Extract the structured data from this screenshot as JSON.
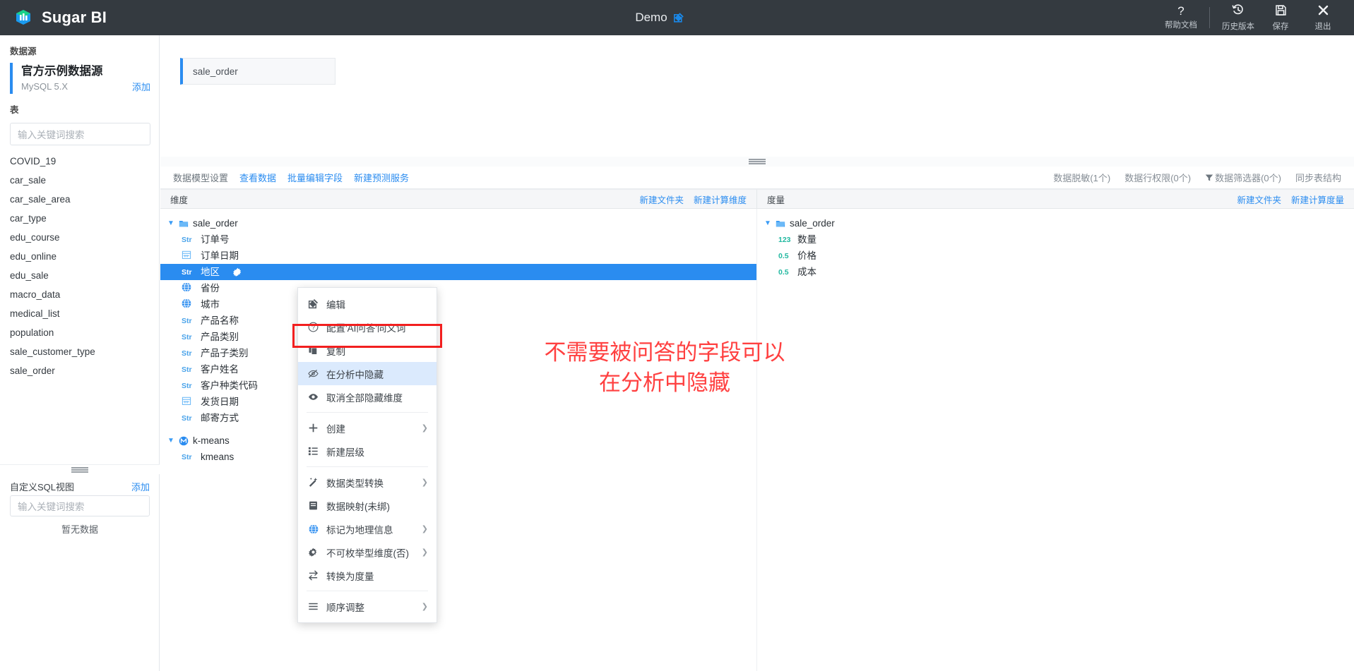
{
  "header": {
    "brand": "Sugar BI",
    "logo_icon": "cube-logo-icon",
    "doc_title": "Demo",
    "edit_icon": "edit-pencil-icon",
    "actions": [
      {
        "icon": "question-mark-icon",
        "glyph": "?",
        "label": "帮助文档"
      },
      {
        "icon": "history-clock-icon",
        "glyph": "",
        "label": "历史版本"
      },
      {
        "icon": "save-floppy-icon",
        "glyph": "",
        "label": "保存"
      },
      {
        "icon": "close-x-icon",
        "glyph": "✕",
        "label": "退出"
      }
    ]
  },
  "sidebar": {
    "datasource_label": "数据源",
    "datasource": {
      "name": "官方示例数据源",
      "sub": "MySQL 5.X",
      "add_label": "添加"
    },
    "tables_label": "表",
    "table_search_placeholder": "输入关键词搜索",
    "tables": [
      "COVID_19",
      "car_sale",
      "car_sale_area",
      "car_type",
      "edu_course",
      "edu_online",
      "edu_sale",
      "macro_data",
      "medical_list",
      "population",
      "sale_customer_type",
      "sale_order"
    ],
    "sqlview": {
      "title": "自定义SQL视图",
      "add_label": "添加",
      "search_placeholder": "输入关键词搜索",
      "empty_text": "暂无数据"
    }
  },
  "canvas": {
    "node_label": "sale_order"
  },
  "model_toolbar": {
    "left": [
      {
        "text": "数据模型设置",
        "link": false
      },
      {
        "text": "查看数据",
        "link": true
      },
      {
        "text": "批量编辑字段",
        "link": true
      },
      {
        "text": "新建预测服务",
        "link": true
      }
    ],
    "right": [
      {
        "text": "数据脱敏(1个)",
        "icon": ""
      },
      {
        "text": "数据行权限(0个)",
        "icon": ""
      },
      {
        "text": "数据筛选器(0个)",
        "icon": "filter-funnel-icon"
      },
      {
        "text": "同步表结构",
        "icon": ""
      }
    ]
  },
  "dimension_panel": {
    "title": "维度",
    "links": [
      "新建文件夹",
      "新建计算维度"
    ],
    "groups": [
      {
        "name": "sale_order",
        "icon": "folder-icon",
        "fields": [
          {
            "label": "订单号",
            "type": "Str",
            "icon": "string-type-icon"
          },
          {
            "label": "订单日期",
            "type": "date",
            "icon": "calendar-icon"
          },
          {
            "label": "地区",
            "type": "Str",
            "icon": "string-type-icon",
            "selected": true,
            "gear": "gear-icon"
          },
          {
            "label": "省份",
            "type": "geo",
            "icon": "globe-icon"
          },
          {
            "label": "城市",
            "type": "geo",
            "icon": "globe-icon"
          },
          {
            "label": "产品名称",
            "type": "Str",
            "icon": "string-type-icon"
          },
          {
            "label": "产品类别",
            "type": "Str",
            "icon": "string-type-icon"
          },
          {
            "label": "产品子类别",
            "type": "Str",
            "icon": "string-type-icon"
          },
          {
            "label": "客户姓名",
            "type": "Str",
            "icon": "string-type-icon"
          },
          {
            "label": "客户种类代码",
            "type": "Str",
            "icon": "string-type-icon"
          },
          {
            "label": "发货日期",
            "type": "date",
            "icon": "calendar-icon"
          },
          {
            "label": "邮寄方式",
            "type": "Str",
            "icon": "string-type-icon"
          }
        ]
      },
      {
        "name": "k-means",
        "icon": "model-circle-icon",
        "fields": [
          {
            "label": "kmeans",
            "type": "Str",
            "icon": "string-type-icon"
          }
        ]
      }
    ]
  },
  "measure_panel": {
    "title": "度量",
    "links": [
      "新建文件夹",
      "新建计算度量"
    ],
    "groups": [
      {
        "name": "sale_order",
        "icon": "folder-icon",
        "fields": [
          {
            "label": "数量",
            "type": "123",
            "icon": "integer-type-icon"
          },
          {
            "label": "价格",
            "type": "0.5",
            "icon": "decimal-type-icon"
          },
          {
            "label": "成本",
            "type": "0.5",
            "icon": "decimal-type-icon"
          }
        ]
      }
    ]
  },
  "context_menu": {
    "items": [
      {
        "label": "编辑",
        "icon": "edit-square-icon",
        "arrow": false,
        "active": false,
        "sep_after": false
      },
      {
        "label": "配置'AI问答'同义词",
        "icon": "question-circle-icon",
        "arrow": false,
        "active": false,
        "sep_after": false
      },
      {
        "label": "复制",
        "icon": "copy-icon",
        "arrow": false,
        "active": false,
        "sep_after": false
      },
      {
        "label": "在分析中隐藏",
        "icon": "eye-slash-icon",
        "arrow": false,
        "active": true,
        "sep_after": false
      },
      {
        "label": "取消全部隐藏维度",
        "icon": "eye-icon",
        "arrow": false,
        "active": false,
        "sep_after": true
      },
      {
        "label": "创建",
        "icon": "plus-icon",
        "arrow": true,
        "active": false,
        "sep_after": false
      },
      {
        "label": "新建层级",
        "icon": "hierarchy-icon",
        "arrow": false,
        "active": false,
        "sep_after": true
      },
      {
        "label": "数据类型转换",
        "icon": "magic-wand-icon",
        "arrow": true,
        "active": false,
        "sep_after": false
      },
      {
        "label": "数据映射(未绑)",
        "icon": "book-icon",
        "arrow": false,
        "active": false,
        "sep_after": false
      },
      {
        "label": "标记为地理信息",
        "icon": "globe-icon",
        "arrow": true,
        "active": false,
        "sep_after": false
      },
      {
        "label": "不可枚举型维度(否)",
        "icon": "gear-icon",
        "arrow": true,
        "active": false,
        "sep_after": false
      },
      {
        "label": "转换为度量",
        "icon": "swap-arrows-icon",
        "arrow": false,
        "active": false,
        "sep_after": true
      },
      {
        "label": "顺序调整",
        "icon": "list-lines-icon",
        "arrow": true,
        "active": false,
        "sep_after": false
      }
    ]
  },
  "annotation": {
    "line1": "不需要被问答的字段可以",
    "line2": "在分析中隐藏",
    "color": "#ff4040"
  },
  "colors": {
    "accent": "#2a8cf0",
    "header_bg": "#343a40",
    "selected_row": "#2a8cf0",
    "measure_type": "#22b8a0",
    "highlight_border": "#f21f1f"
  }
}
